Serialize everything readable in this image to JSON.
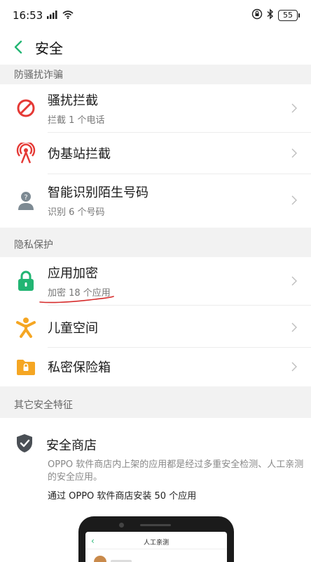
{
  "status_bar": {
    "time": "16:53",
    "network": "4G",
    "battery": "55"
  },
  "header": {
    "title": "安全"
  },
  "sections": [
    {
      "title": "防骚扰诈骗",
      "items": [
        {
          "title": "骚扰拦截",
          "subtitle": "拦截 1 个电话",
          "icon": "block-icon"
        },
        {
          "title": "伪基站拦截",
          "subtitle": "",
          "icon": "radar-icon"
        },
        {
          "title": "智能识别陌生号码",
          "subtitle": "识别 6 个号码",
          "icon": "unknown-person-icon"
        }
      ]
    },
    {
      "title": "隐私保护",
      "items": [
        {
          "title": "应用加密",
          "subtitle": "加密 18 个应用",
          "icon": "lock-icon"
        },
        {
          "title": "儿童空间",
          "subtitle": "",
          "icon": "child-icon"
        },
        {
          "title": "私密保险箱",
          "subtitle": "",
          "icon": "safe-folder-icon"
        }
      ]
    },
    {
      "title": "其它安全特征"
    }
  ],
  "store": {
    "title": "安全商店",
    "description": "OPPO 软件商店内上架的应用都是经过多重安全检测、人工亲测的安全应用。",
    "count_text": "通过 OPPO 软件商店安装 50 个应用",
    "preview_title": "人工亲测"
  },
  "colors": {
    "accent_green": "#22b573",
    "block_red": "#e53935",
    "orange": "#f5a623",
    "annotation_red": "#d62b2b"
  }
}
